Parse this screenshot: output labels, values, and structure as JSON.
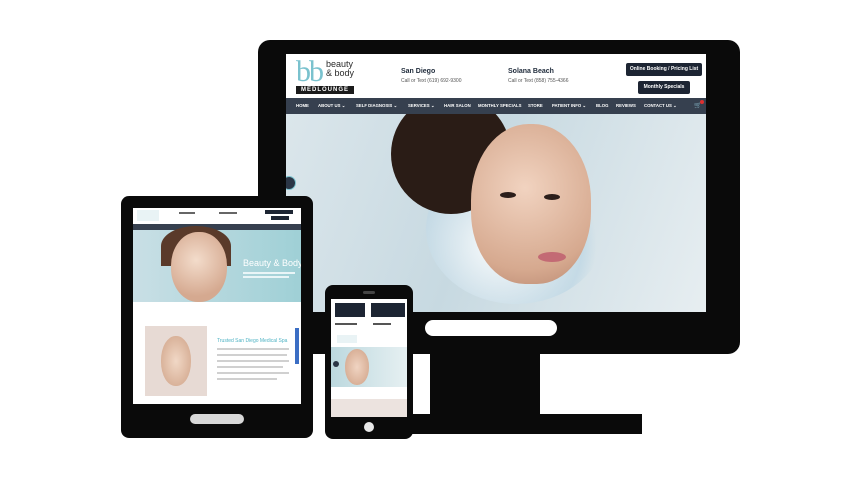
{
  "desktop": {
    "logo": {
      "mark": "bb",
      "line1": "beauty",
      "line2": "& body",
      "bar": "MEDLOUNGE"
    },
    "locations": [
      {
        "name": "San Diego",
        "phone": "Call or Text (619) 692-9300"
      },
      {
        "name": "Solana Beach",
        "phone": "Call or Text (858) 755-4366"
      }
    ],
    "buttons": {
      "booking": "Online Booking / Pricing List",
      "specials": "Monthly Specials"
    },
    "nav": [
      "HOME",
      "ABOUT US ⌄",
      "SELF DIAGNOSIS ⌄",
      "SERVICES ⌄",
      "HAIR SALON",
      "MONTHLY SPECIALS",
      "STORE",
      "PATIENT INFO ⌄",
      "BLOG",
      "REVIEWS",
      "CONTACT US ⌄"
    ],
    "cart_icon": "cart-icon"
  },
  "tablet": {
    "hero_title": "Beauty & Body",
    "section_heading": "Trusted San Diego Medical Spa"
  },
  "colors": {
    "nav": "#36404f",
    "button": "#1d2533",
    "accent": "#7ac2ce",
    "device": "#0a0a0a"
  }
}
